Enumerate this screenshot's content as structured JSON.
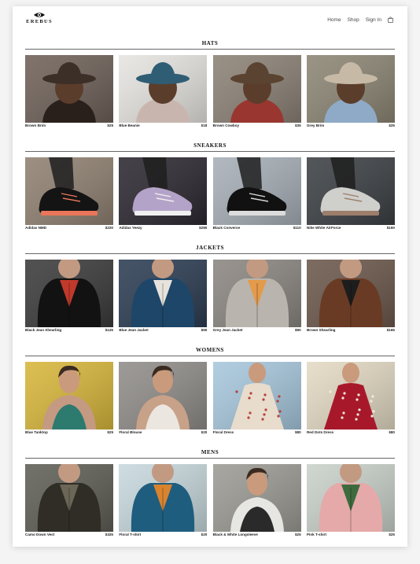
{
  "brand": {
    "name": "EREBUS"
  },
  "nav": {
    "home": "Home",
    "shop": "Shop",
    "signin": "Sign In",
    "cart_icon": "bag-icon"
  },
  "sections": [
    {
      "title": "HATS",
      "items": [
        {
          "name": "Brown Brim",
          "price": "$25",
          "bg": "#6e6058",
          "fg": "#3c2f28",
          "accent": "#2a201b"
        },
        {
          "name": "Blue Beanie",
          "price": "$18",
          "bg": "#e6e4e0",
          "fg": "#2f5d74",
          "accent": "#c8b6ae"
        },
        {
          "name": "Brown Cowboy",
          "price": "$35",
          "bg": "#8b8175",
          "fg": "#5a4330",
          "accent": "#9a3630"
        },
        {
          "name": "Grey Brim",
          "price": "$25",
          "bg": "#8c8574",
          "fg": "#c6b9a6",
          "accent": "#8faac6"
        }
      ]
    },
    {
      "title": "SNEAKERS",
      "items": [
        {
          "name": "Adidas NMD",
          "price": "$220",
          "bg": "#8f8071",
          "fg": "#141414",
          "accent": "#e9765a"
        },
        {
          "name": "Adidas Yeezy",
          "price": "$280",
          "bg": "#2c2730",
          "fg": "#b4a3c8",
          "accent": "#f0f0f0"
        },
        {
          "name": "Black Converse",
          "price": "$110",
          "bg": "#a6aeb6",
          "fg": "#111111",
          "accent": "#dcdcdc"
        },
        {
          "name": "Nike White AirForce",
          "price": "$160",
          "bg": "#3b3f43",
          "fg": "#cfcfcc",
          "accent": "#9c7e6b"
        }
      ]
    },
    {
      "title": "JACKETS",
      "items": [
        {
          "name": "Black Jean Shearling",
          "price": "$125",
          "bg": "#3a3a3a",
          "fg": "#121212",
          "accent": "#c0392b"
        },
        {
          "name": "Blue Jean Jacket",
          "price": "$90",
          "bg": "#2b3c52",
          "fg": "#1e4668",
          "accent": "#e7e3dc"
        },
        {
          "name": "Grey Jean Jacket",
          "price": "$90",
          "bg": "#8a8580",
          "fg": "#b9b4ad",
          "accent": "#e39a4a"
        },
        {
          "name": "Brown Shearling",
          "price": "$165",
          "bg": "#6b574b",
          "fg": "#6a3b24",
          "accent": "#1d1d1d"
        }
      ]
    },
    {
      "title": "WOMENS",
      "items": [
        {
          "name": "Blue Tanktop",
          "price": "$25",
          "bg": "#d7b63a",
          "fg": "#c49a82",
          "accent": "#2d7a6f"
        },
        {
          "name": "Floral Blouse",
          "price": "$20",
          "bg": "#8f8c88",
          "fg": "#c7a188",
          "accent": "#ece6e0"
        },
        {
          "name": "Floral Dress",
          "price": "$80",
          "bg": "#a6c7dc",
          "fg": "#e8dccc",
          "accent": "#b5413c"
        },
        {
          "name": "Red Dots Dress",
          "price": "$80",
          "bg": "#e3d9c3",
          "fg": "#a7192a",
          "accent": "#f2e8da"
        }
      ]
    },
    {
      "title": "MENS",
      "items": [
        {
          "name": "Camo Down Vest",
          "price": "$325",
          "bg": "#5e5d55",
          "fg": "#2f2d26",
          "accent": "#6b6656"
        },
        {
          "name": "Floral T-shirt",
          "price": "$20",
          "bg": "#c7d8dd",
          "fg": "#1f5d7f",
          "accent": "#d9832f"
        },
        {
          "name": "Black & White Longsleeve",
          "price": "$25",
          "bg": "#9b9a93",
          "fg": "#e6e6e3",
          "accent": "#2a2a2a"
        },
        {
          "name": "Pink T-shirt",
          "price": "$25",
          "bg": "#c9d1c9",
          "fg": "#e6a9a9",
          "accent": "#3d6b3d"
        }
      ]
    }
  ]
}
